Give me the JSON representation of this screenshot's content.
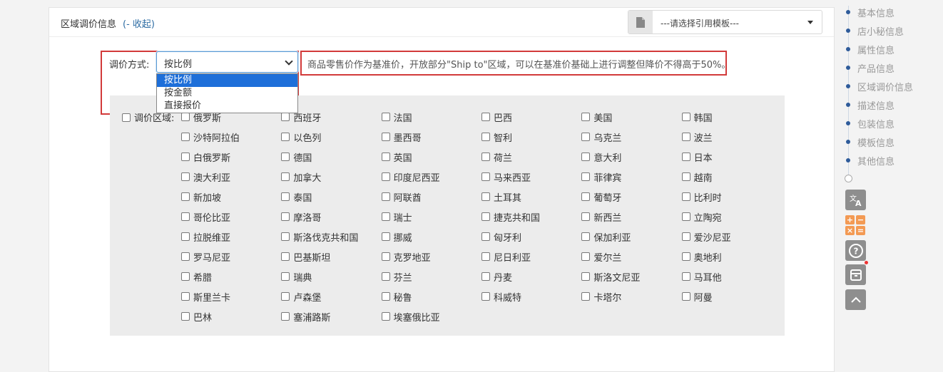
{
  "panel": {
    "title": "区域调价信息",
    "collapse_label": "(- 收起)",
    "template_placeholder": "---请选择引用模板---"
  },
  "pricing_method": {
    "label": "调价方式:",
    "selected": "按比例",
    "options": [
      "按比例",
      "按金额",
      "直接报价"
    ],
    "hint": "商品零售价作为基准价，开放部分\"Ship to\"区域，可以在基准价基础上进行调整但降价不得高于50%。"
  },
  "region": {
    "label": "调价区域:",
    "countries": [
      "俄罗斯",
      "西班牙",
      "法国",
      "巴西",
      "美国",
      "韩国",
      "沙特阿拉伯",
      "以色列",
      "墨西哥",
      "智利",
      "乌克兰",
      "波兰",
      "白俄罗斯",
      "德国",
      "英国",
      "荷兰",
      "意大利",
      "日本",
      "澳大利亚",
      "加拿大",
      "印度尼西亚",
      "马来西亚",
      "菲律宾",
      "越南",
      "新加坡",
      "泰国",
      "阿联酋",
      "土耳其",
      "葡萄牙",
      "比利时",
      "哥伦比亚",
      "摩洛哥",
      "瑞士",
      "捷克共和国",
      "新西兰",
      "立陶宛",
      "拉脱维亚",
      "斯洛伐克共和国",
      "挪威",
      "匈牙利",
      "保加利亚",
      "爱沙尼亚",
      "罗马尼亚",
      "巴基斯坦",
      "克罗地亚",
      "尼日利亚",
      "爱尔兰",
      "奥地利",
      "希腊",
      "瑞典",
      "芬兰",
      "丹麦",
      "斯洛文尼亚",
      "马耳他",
      "斯里兰卡",
      "卢森堡",
      "秘鲁",
      "科威特",
      "卡塔尔",
      "阿曼",
      "巴林",
      "塞浦路斯",
      "埃塞俄比亚"
    ]
  },
  "side_nav": {
    "items": [
      "基本信息",
      "店小秘信息",
      "属性信息",
      "产品信息",
      "区域调价信息",
      "描述信息",
      "包装信息",
      "模板信息",
      "其他信息"
    ]
  },
  "tools": {
    "translate_icon": "translate-icon",
    "calculator_icon": "calculator-icon",
    "help_icon": "help-icon",
    "archive_icon": "archive-icon",
    "top_icon": "chevron-up-icon",
    "calc_symbols": [
      "+",
      "−",
      "×",
      "="
    ]
  },
  "colors": {
    "accent": "#2e6da4",
    "highlight_border": "#d23a3a",
    "dropdown_selected": "#1e6fd9",
    "nav_dot": "#2e5b9a",
    "calc_orange": "#f39a54"
  }
}
